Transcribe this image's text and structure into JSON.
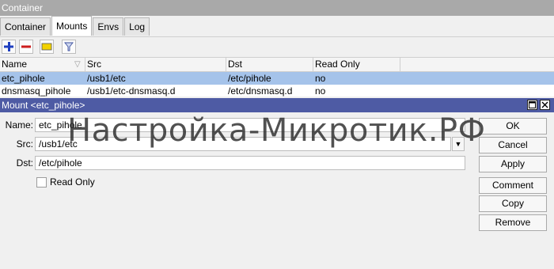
{
  "window": {
    "title": "Container"
  },
  "tabs": [
    {
      "label": "Container",
      "active": false
    },
    {
      "label": "Mounts",
      "active": true
    },
    {
      "label": "Envs",
      "active": false
    },
    {
      "label": "Log",
      "active": false
    }
  ],
  "toolbar": {
    "icons": [
      "add-icon",
      "remove-icon",
      "comment-icon",
      "filter-icon"
    ]
  },
  "table": {
    "columns": [
      "Name",
      "Src",
      "Dst",
      "Read Only"
    ],
    "rows": [
      [
        "etc_pihole",
        "/usb1/etc",
        "/etc/pihole",
        "no"
      ],
      [
        "dnsmasq_pihole",
        "/usb1/etc-dnsmasq.d",
        "/etc/dnsmasq.d",
        "no"
      ]
    ],
    "selected_row": 0
  },
  "dialog": {
    "title": "Mount <etc_pihole>",
    "fields": {
      "name_label": "Name:",
      "name_value": "etc_pihole",
      "src_label": "Src:",
      "src_value": "/usb1/etc",
      "dst_label": "Dst:",
      "dst_value": "/etc/pihole",
      "readonly_label": "Read Only",
      "readonly_checked": false
    },
    "buttons": {
      "ok": "OK",
      "cancel": "Cancel",
      "apply": "Apply",
      "comment": "Comment",
      "copy": "Copy",
      "remove": "Remove"
    }
  },
  "watermark": "Настройка-Микротик.РФ",
  "colors": {
    "dialog_titlebar": "#4e5ba4",
    "selected_row": "#a5c3ea",
    "add_icon": "#1f3fbf",
    "remove_icon": "#cc1e1e",
    "comment_icon": "#f2d200"
  }
}
